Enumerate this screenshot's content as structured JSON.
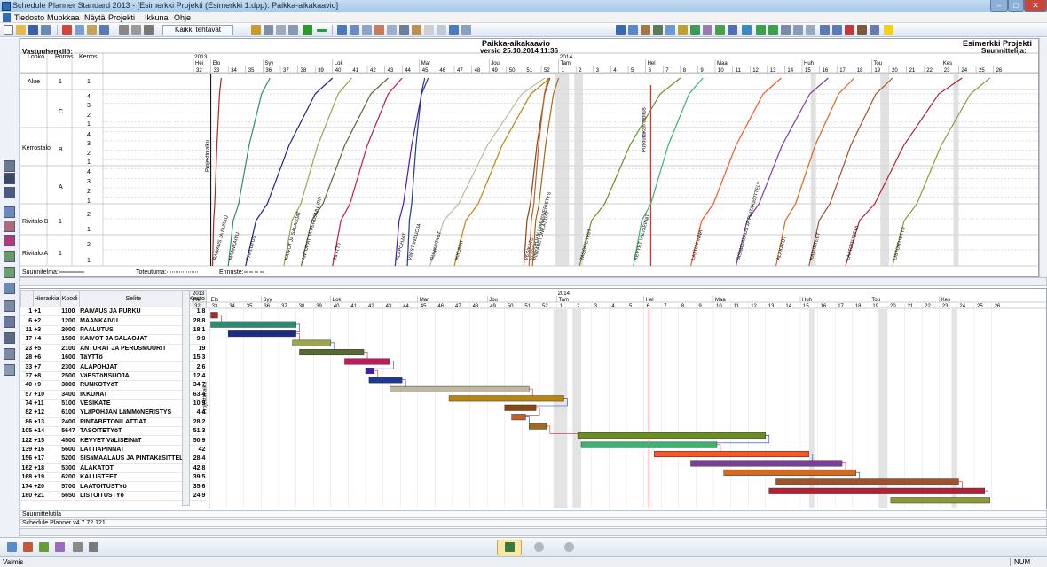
{
  "window": {
    "title": "Schedule Planner Standard 2013 - [Esimerkki Projekti (Esimerkki 1.dpp): Paikka-aikakaavio]",
    "min_label": "‒",
    "max_label": "□",
    "close_label": "✕"
  },
  "menu": [
    "Tiedosto",
    "Muokkaa",
    "Näytä",
    "Projekti",
    "Ikkuna",
    "Ohje"
  ],
  "toolbar": {
    "filter_label": "Kaikki tehtävät"
  },
  "chart_header": {
    "title": "Paikka-aikakaavio",
    "version": "versio 25.10.2014 11:36",
    "project": "Esimerkki Projekti",
    "planner_label": "Suunnittelija:",
    "responsible_label": "Vastuuhenkilö:"
  },
  "location_columns": [
    "Lohko",
    "Porras",
    "Kerros"
  ],
  "locations": {
    "alue": "Alue",
    "kerrostalo": "Kerrostalo",
    "rivitalo_b": "Rivitalo B",
    "rivitalo_a": "Rivitalo A",
    "porras_c": "C",
    "porras_b": "B",
    "porras_a": "A",
    "porras_1": "1",
    "floors_c": [
      "4",
      "3",
      "2",
      "1"
    ],
    "floors_b": [
      "4",
      "3",
      "2",
      "1"
    ],
    "floors_a": [
      "4",
      "3",
      "2",
      "1"
    ],
    "floors_rb": [
      "2",
      "1"
    ],
    "floors_ra": [
      "2",
      "1"
    ],
    "floor_alue": "1"
  },
  "timeline": {
    "year_2013": "2013",
    "year_2014": "2014",
    "months": [
      "Hei",
      "Elo",
      "Syy",
      "Lok",
      "Mar",
      "Jou",
      "Tam",
      "Hel",
      "Maa",
      "Huh",
      "Tou",
      "Kes"
    ],
    "weeks": [
      "32",
      "33",
      "34",
      "35",
      "36",
      "37",
      "38",
      "39",
      "40",
      "41",
      "42",
      "43",
      "44",
      "45",
      "46",
      "47",
      "48",
      "49",
      "50",
      "51",
      "52",
      "1",
      "2",
      "3",
      "4",
      "5",
      "6",
      "7",
      "8",
      "9",
      "10",
      "11",
      "12",
      "13",
      "14",
      "15",
      "16",
      "17",
      "18",
      "19",
      "20",
      "21",
      "22",
      "23",
      "24",
      "25",
      "26"
    ]
  },
  "legend": {
    "planned": "Suunnitelma:",
    "actual": "Toteutuma:",
    "forecast": "Ennuste:"
  },
  "annotations": {
    "project_start": "Projektin alku",
    "pipe_marker": "Putkiurakan aloitus"
  },
  "task_table": {
    "headers": [
      "Hierarkia",
      "Koodi",
      "Selite",
      "Kesto"
    ],
    "rows": [
      [
        "1",
        "+1",
        "1100",
        "RAIVAUS JA PURKU",
        "1.8"
      ],
      [
        "6",
        "+2",
        "1200",
        "MAANKAIVU",
        "28.8"
      ],
      [
        "11",
        "+3",
        "2000",
        "PAALUTUS",
        "18.1"
      ],
      [
        "17",
        "+4",
        "1500",
        "KAIVOT JA SALAOJAT",
        "9.9"
      ],
      [
        "23",
        "+5",
        "2100",
        "ANTURAT JA PERUSMUURIT",
        "19"
      ],
      [
        "28",
        "+6",
        "1600",
        "TäYTTö",
        "15.3"
      ],
      [
        "33",
        "+7",
        "2300",
        "ALAPOHJAT",
        "2.6"
      ],
      [
        "37",
        "+8",
        "2500",
        "VäESTöNSUOJA",
        "12.4"
      ],
      [
        "40",
        "+9",
        "3800",
        "RUNKOTYöT",
        "34.7"
      ],
      [
        "57",
        "+10",
        "3400",
        "IKKUNAT",
        "63.4"
      ],
      [
        "74",
        "+11",
        "5100",
        "VESIKATE",
        "10.9"
      ],
      [
        "82",
        "+12",
        "6100",
        "YLäPOHJAN LäMMöNERISTYS",
        "4.4"
      ],
      [
        "86",
        "+13",
        "2400",
        "PINTABETONILATTIAT",
        "28.2"
      ],
      [
        "105",
        "+14",
        "5647",
        "TASOITETYöT",
        "51.3"
      ],
      [
        "122",
        "+15",
        "4500",
        "KEVYET VäLISEINäT",
        "50.9"
      ],
      [
        "139",
        "+16",
        "5600",
        "LATTIAPINNAT",
        "42"
      ],
      [
        "156",
        "+17",
        "5200",
        "SISäMAALAUS JA PINTAKäSITTELY",
        "28.4"
      ],
      [
        "162",
        "+18",
        "5300",
        "ALAKATOT",
        "42.8"
      ],
      [
        "168",
        "+19",
        "6200",
        "KALUSTEET",
        "39.5"
      ],
      [
        "174",
        "+20",
        "5700",
        "LAATOITUSTYö",
        "35.6"
      ],
      [
        "180",
        "+21",
        "5650",
        "LISTOITUSTYö",
        "24.9"
      ]
    ]
  },
  "flowline_labels": [
    "RAIVAUS JA PURKU",
    "MAANKAIVU",
    "PAALUTUS",
    "KAIVOT JA SALAOJAT",
    "ANTURAT JA PERUSMUURIT",
    "TäYTTö",
    "ALAPOHJAT",
    "VäESTöNSUOJA",
    "RUNKOTYöT",
    "IKKUNAT",
    "VESIKATE",
    "YLäPOHJAN LäMMöNERISTYS",
    "PINTABETONILATTIAT",
    "TASOITETYöT",
    "KEVYET VäLISEINäT",
    "LATTIAPINNAT",
    "SISäMAALAUS JA PINTAKäSITTELY",
    "ALAKATOT",
    "KALUSTEET",
    "LAATOITUSTYö",
    "LISTOITUSTYö"
  ],
  "colors": {
    "c1": "#a52a2a",
    "c2": "#2e8b72",
    "c3": "#1c2a80",
    "c4": "#9aa64a",
    "c5": "#556b2f",
    "c6": "#c2185b",
    "c7": "#4a1ab4",
    "c8": "#1f3a8a",
    "c9": "#bfb8a0",
    "c10": "#b8860b",
    "c11": "#8b4513",
    "c12": "#c0602a",
    "c13": "#a06a20",
    "c14": "#6b8e23",
    "c15": "#3cb371",
    "c16": "#ff5522",
    "c17": "#7b3f99",
    "c18": "#d46a20",
    "c19": "#a0522d",
    "c20": "#b22234",
    "c21": "#8c9a3a"
  },
  "panel_footer": {
    "state_label": "Suunnittelutila",
    "version_label": "Schedule Planner v4.7.72.121"
  },
  "status": {
    "left": "Valmis",
    "right": "NUM"
  }
}
